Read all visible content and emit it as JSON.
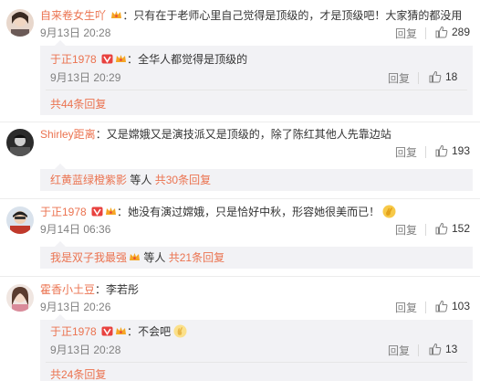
{
  "comments": [
    {
      "user": "自来卷女生吖",
      "text": "只有在于老师心里自己觉得是顶级的，才是顶级吧！大家猜的都没用",
      "date": "9月13日 20:28",
      "reply_label": "回复",
      "likes": "289",
      "replies": [
        {
          "user": "于正1978",
          "text": "全华人都觉得是顶级的",
          "date": "9月13日 20:29",
          "reply_label": "回复",
          "likes": "18"
        }
      ],
      "more": {
        "link": "共44条回复",
        "users": "",
        "suffix": ""
      }
    },
    {
      "user": "Shirley距离",
      "text": "又是嫦娥又是演技派又是顶级的，除了陈红其他人先靠边站",
      "date": "",
      "reply_label": "回复",
      "likes": "193",
      "replies": [],
      "more": {
        "link": "",
        "users": "红黄蓝绿橙紫影",
        "middle": "等人",
        "count": "共30条回复"
      }
    },
    {
      "user": "于正1978",
      "text": "她没有演过嫦娥，只是恰好中秋，形容她很美而已！",
      "date": "9月14日 06:36",
      "reply_label": "回复",
      "likes": "152",
      "replies": [],
      "more": {
        "link": "",
        "users": "我是双子我最强",
        "middle": "等人",
        "count": "共21条回复"
      }
    },
    {
      "user": "霍香小土豆",
      "text": "李若彤",
      "date": "9月13日 20:26",
      "reply_label": "回复",
      "likes": "103",
      "replies": [
        {
          "user": "于正1978",
          "text": "不会吧",
          "date": "9月13日 20:28",
          "reply_label": "回复",
          "likes": "13"
        }
      ],
      "more": {
        "link": "共24条回复",
        "users": "",
        "suffix": ""
      }
    }
  ],
  "colors": {
    "accent": "#eb7350",
    "muted": "#808080",
    "subbox_bg": "#f2f2f5"
  },
  "icons": {
    "like": "thumbs-up-icon",
    "vip": "vip-badge-icon",
    "crown": "crown-badge-icon"
  }
}
